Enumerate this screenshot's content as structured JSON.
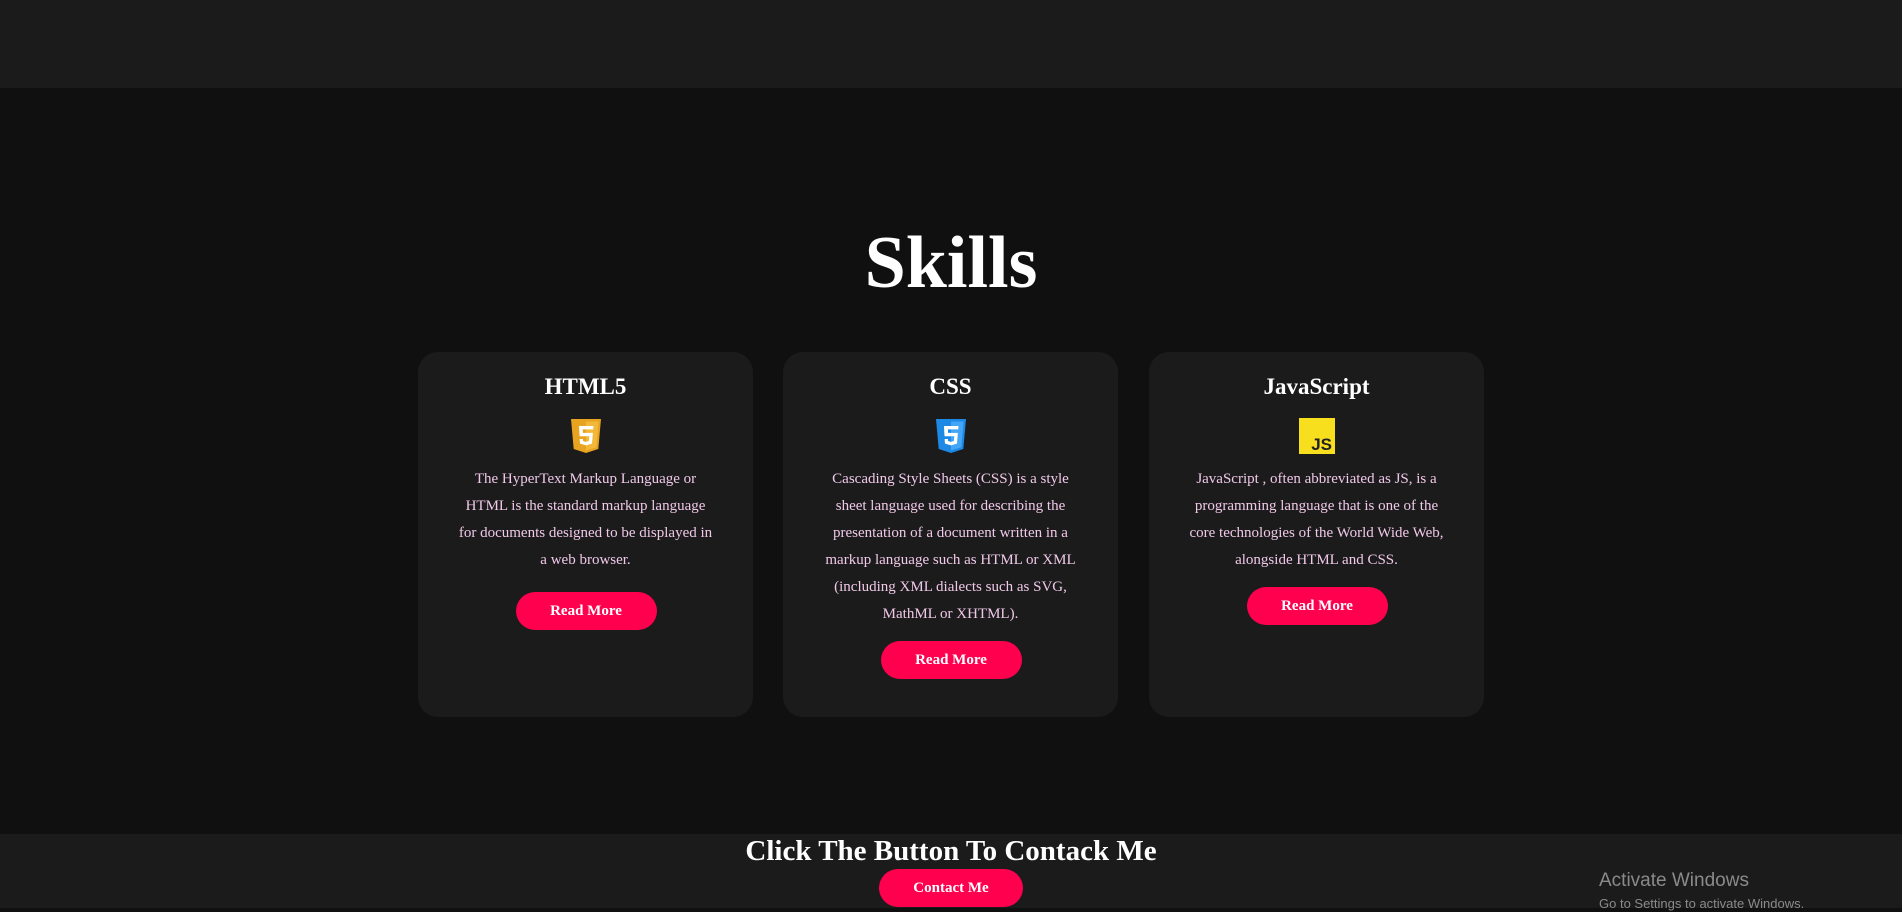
{
  "section": {
    "title": "Skills"
  },
  "cards": [
    {
      "title": "HTML5",
      "icon": "html5-icon",
      "description": "The HyperText Markup Language or HTML is the standard markup language for documents designed to be displayed in a web browser.",
      "button_label": "Read More"
    },
    {
      "title": "CSS",
      "icon": "css3-icon",
      "description": "Cascading Style Sheets (CSS) is a style sheet language used for describing the presentation of a document written in a markup language such as HTML or XML (including XML dialects such as SVG, MathML or XHTML).",
      "button_label": "Read More"
    },
    {
      "title": "JavaScript",
      "icon": "javascript-icon",
      "icon_text": "JS",
      "description": "JavaScript , often abbreviated as JS, is a programming language that is one of the core technologies of the World Wide Web, alongside HTML and CSS.",
      "button_label": "Read More"
    }
  ],
  "footer": {
    "heading": "Click The Button To Contack Me",
    "button_label": "Contact Me"
  },
  "windows_watermark": {
    "title": "Activate Windows",
    "subtitle": "Go to Settings to activate Windows."
  },
  "colors": {
    "background": "#101011",
    "panel": "#1b1b1c",
    "accent": "#ff004f",
    "description_text": "#f0c8e8",
    "html5_orange": "#e8a320",
    "css3_blue": "#2196f3",
    "js_yellow": "#f7df1e"
  }
}
